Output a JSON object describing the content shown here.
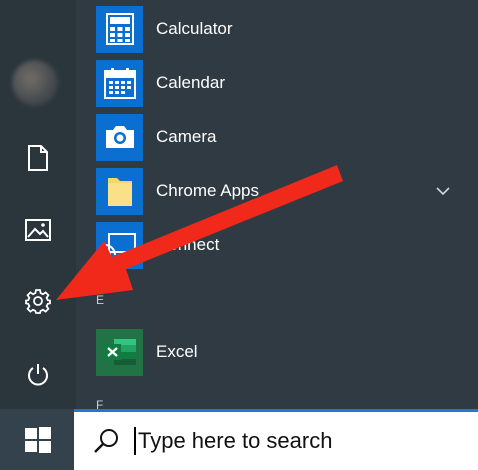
{
  "rail": {
    "items": [
      {
        "icon": "user-avatar",
        "label": ""
      },
      {
        "icon": "document-icon"
      },
      {
        "icon": "pictures-icon"
      },
      {
        "icon": "settings-gear-icon"
      },
      {
        "icon": "power-icon"
      }
    ]
  },
  "apps": [
    {
      "label": "Calculator",
      "icon": "calculator-icon",
      "color": "#0a6fd1"
    },
    {
      "label": "Calendar",
      "icon": "calendar-icon",
      "color": "#0a6fd1"
    },
    {
      "label": "Camera",
      "icon": "camera-icon",
      "color": "#0a6fd1"
    },
    {
      "label": "Chrome Apps",
      "icon": "folder-icon",
      "color": "#0a6fd1"
    },
    {
      "label": "Connect",
      "icon": "connect-icon",
      "color": "#0a6fd1"
    },
    {
      "label": "Excel",
      "icon": "excel-icon",
      "color": "#217346"
    }
  ],
  "section_letters": [
    "E",
    "F"
  ],
  "taskbar": {
    "search_placeholder": "Type here to search"
  },
  "annotation": {
    "color": "#f0291a",
    "icon": "red-arrow-pointing-to-settings"
  }
}
